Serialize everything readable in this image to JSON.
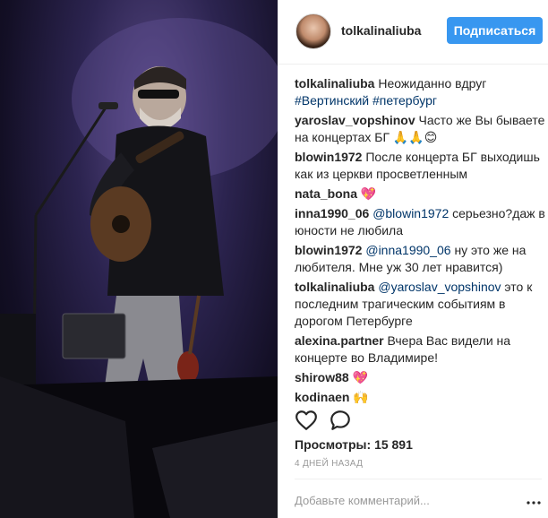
{
  "header": {
    "username": "tolkalinaliuba",
    "follow_label": "Подписаться"
  },
  "caption": {
    "user": "tolkalinaliuba",
    "text": "Неожиданно вдруг",
    "hashtags": "#Вертинский #петербург"
  },
  "comments": [
    {
      "user": "yaroslav_vopshinov",
      "mention": "",
      "text": "Часто же Вы бываете на концертах БГ 🙏🙏😊"
    },
    {
      "user": "blowin1972",
      "mention": "",
      "text": "После концерта БГ выходишь как из церкви просветленным"
    },
    {
      "user": "nata_bona",
      "mention": "",
      "text": "💖"
    },
    {
      "user": "inna1990_06",
      "mention": "@blowin1972",
      "text": "серьезно?даж в юности не любила"
    },
    {
      "user": "blowin1972",
      "mention": "@inna1990_06",
      "text": "ну это же на любителя. Мне уж 30 лет нравится)"
    },
    {
      "user": "tolkalinaliuba",
      "mention": "@yaroslav_vopshinov",
      "text": "это к последним трагическим событиям в дорогом Петербурге"
    },
    {
      "user": "alexina.partner",
      "mention": "",
      "text": "Вчера Вас видели на концерте во Владимире!"
    },
    {
      "user": "shirow88",
      "mention": "",
      "text": "💖"
    },
    {
      "user": "kodinaen",
      "mention": "",
      "text": "🙌"
    }
  ],
  "actions": {
    "like_icon": "heart-icon",
    "comment_icon": "comment-icon"
  },
  "stats": {
    "views_label": "Просмотры:",
    "views_count": "15 891",
    "time_ago": "4 ДНЕЙ НАЗАД"
  },
  "add_comment": {
    "placeholder": "Добавьте комментарий..."
  },
  "colors": {
    "follow_button": "#3897f0",
    "link": "#003569",
    "muted": "#999999"
  }
}
